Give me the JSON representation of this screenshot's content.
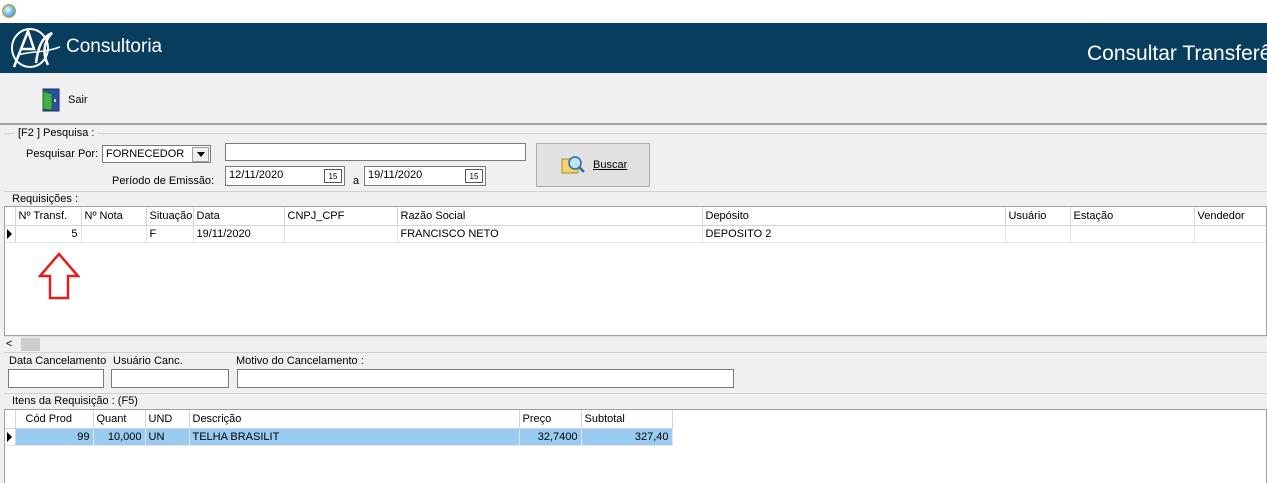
{
  "window": {
    "title": ""
  },
  "banner": {
    "logo_text": "Consultoria",
    "title": "Consultar Transferências"
  },
  "toolbar": {
    "exit_label": "Sair"
  },
  "search_group": {
    "title": "[F2 ]  Pesquisa :",
    "search_by_label": "Pesquisar Por:",
    "search_by_value": "FORNECEDOR",
    "search_text_value": "",
    "period_label": "Período de Emissão:",
    "date_from": "12/11/2020",
    "date_sep": "a",
    "date_to": "19/11/2020",
    "search_button_label": "Buscar"
  },
  "requisitions": {
    "title": "Requisições :",
    "columns": [
      "Nº Transf.",
      "Nº Nota",
      "Situação",
      "Data",
      "CNPJ_CPF",
      "Razão Social",
      "Depósito",
      "Usuário",
      "Estação",
      "Vendedor"
    ],
    "rows": [
      {
        "transf": "5",
        "nota": "",
        "situacao": "F",
        "data": "19/11/2020",
        "cnpj": "",
        "razao": "FRANCISCO NETO",
        "deposito": "DEPOSITO 2",
        "usuario": "",
        "estacao": "",
        "vendedor": ""
      }
    ]
  },
  "cancellation": {
    "date_label": "Data Cancelamento",
    "user_label": "Usuário Canc.",
    "reason_label": "Motivo do Cancelamento  :",
    "date_value": "",
    "user_value": "",
    "reason_value": ""
  },
  "items": {
    "title": "Itens da Requisição : (F5)",
    "columns": [
      "Cód Prod",
      "Quant",
      "UND",
      "Descrição",
      "Preço",
      "Subtotal"
    ],
    "rows": [
      {
        "cod": "99",
        "quant": "10,000",
        "und": "UN",
        "descricao": "TELHA BRASILIT",
        "preco": "32,7400",
        "subtotal": "327,40"
      }
    ]
  },
  "colors": {
    "banner_bg": "#083d5e",
    "selected_row": "#99ccf0",
    "annotation_arrow": "#e02020"
  },
  "icons": [
    "app-icon",
    "logo-icon",
    "exit-door-icon",
    "calendar-icon",
    "search-binoculars-icon",
    "dropdown-arrow-icon",
    "row-pointer-icon",
    "scroll-left-icon",
    "red-up-arrow-annotation"
  ]
}
